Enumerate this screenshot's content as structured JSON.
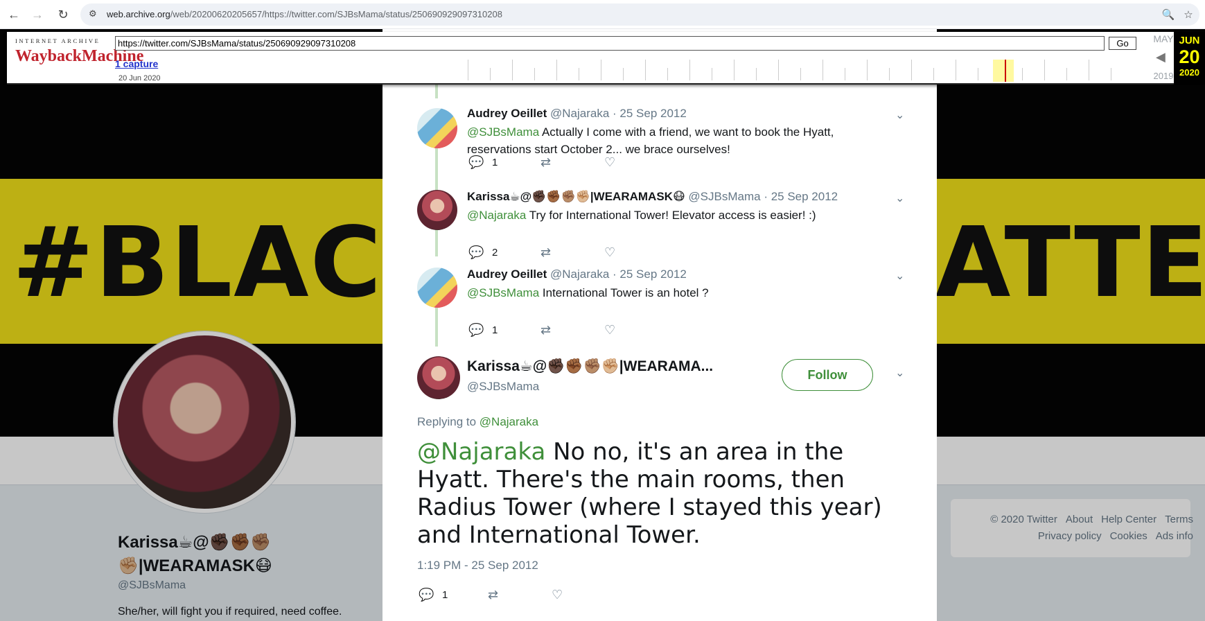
{
  "browser": {
    "url_domain": "web.archive.org",
    "url_rest": "/web/20200620205657/https://twitter.com/SJBsMama/status/250690929097310208"
  },
  "wayback": {
    "logo_top": "INTERNET ARCHIVE",
    "logo_main": "WaybackMachine",
    "url_value": "https://twitter.com/SJBsMama/status/250690929097310208",
    "go_label": "Go",
    "captures_label": "1 capture",
    "capture_date": "20 Jun 2020",
    "prev_month": "MAY",
    "prev_year": "2019",
    "current_month": "JUN",
    "current_day": "20",
    "current_year": "2020"
  },
  "profile": {
    "banner_text_left": "#BLAC",
    "banner_text_right": "ATTE",
    "name": "Karissa☕@✊🏿✊🏾✊🏽✊🏼|WEARAMASK😷",
    "handle": "@SJBsMama",
    "bio": "She/her, will fight you if required, need coffee."
  },
  "footer": {
    "links": [
      "© 2020 Twitter",
      "About",
      "Help Center",
      "Terms",
      "Privacy policy",
      "Cookies",
      "Ads info"
    ]
  },
  "thread": [
    {
      "name": "Audrey Oeillet",
      "handle": "@Najaraka",
      "date": "· 25 Sep 2012",
      "mention": "@SJBsMama",
      "text": " Actually I come with a friend, we want to book the Hyatt, reservations start October 2... we brace ourselves!",
      "replies": "1"
    },
    {
      "name": "Karissa☕@✊🏿✊🏾✊🏽✊🏼|WEARAMASK😷",
      "handle": "@SJBsMama",
      "date": "· 25 Sep 2012",
      "mention": "@Najaraka",
      "text": " Try for International Tower! Elevator access is easier! :)",
      "replies": "2"
    },
    {
      "name": "Audrey Oeillet",
      "handle": "@Najaraka",
      "date": "· 25 Sep 2012",
      "mention": "@SJBsMama",
      "text": " International Tower is an hotel ?",
      "replies": "1"
    }
  ],
  "main_tweet": {
    "name": "Karissa☕@✊🏿✊🏾✊🏽✊🏼|WEARAMA...",
    "handle": "@SJBsMama",
    "follow_label": "Follow",
    "replying_prefix": "Replying to ",
    "replying_to": "@Najaraka",
    "mention": "@Najaraka",
    "text": " No no, it's an area in the Hyatt. There's the main rooms, then Radius Tower (where I stayed this year) and International Tower.",
    "timestamp": "1:19 PM - 25 Sep 2012",
    "replies": "1"
  },
  "colors": {
    "accent_green": "#3f8f3a",
    "banner_yellow": "#f2e21a",
    "wayback_red": "#c0232d"
  }
}
